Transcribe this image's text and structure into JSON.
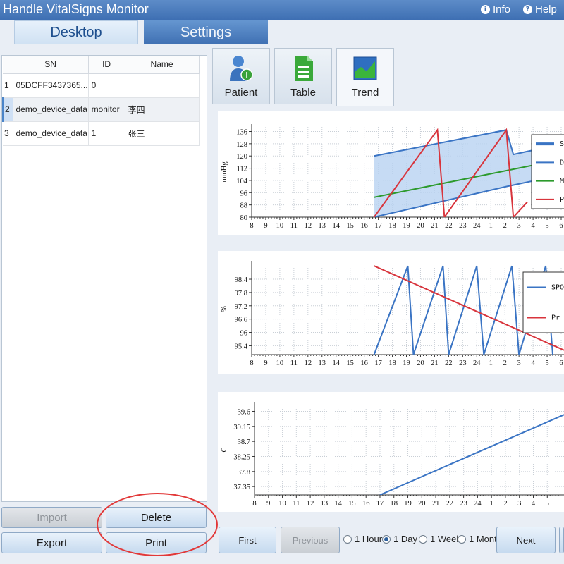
{
  "app": {
    "title": "Handle VitalSigns Monitor",
    "info_label": "Info",
    "help_label": "Help"
  },
  "tabs": {
    "desktop": "Desktop",
    "settings": "Settings"
  },
  "devices": {
    "columns": [
      "SN",
      "ID",
      "Name"
    ],
    "rows": [
      {
        "num": "1",
        "sn": "05DCFF3437365...",
        "id": "0",
        "name": ""
      },
      {
        "num": "2",
        "sn": "demo_device_data",
        "id": "monitor",
        "name": "李四"
      },
      {
        "num": "3",
        "sn": "demo_device_data",
        "id": "1",
        "name": "张三"
      }
    ],
    "selected_row": 2
  },
  "buttons": {
    "import": "Import",
    "delete": "Delete",
    "export": "Export",
    "print": "Print",
    "first": "First",
    "previous": "Previous",
    "next": "Next"
  },
  "view_tabs": {
    "patient": "Patient",
    "table": "Table",
    "trend": "Trend"
  },
  "ranges": [
    {
      "label": "1 Hour",
      "selected": false
    },
    {
      "label": "1 Day",
      "selected": true
    },
    {
      "label": "1 Weel",
      "selected": false
    },
    {
      "label": "1 Mont",
      "selected": false
    }
  ],
  "colors": {
    "blue": "#3a74c4",
    "green": "#2c9a2c",
    "red": "#d8343c",
    "band": "#b8d2f1",
    "highlight": "#e23838"
  },
  "chart_data": [
    {
      "type": "line",
      "ylabel": "mmHg",
      "xticks": [
        "8",
        "9",
        "10",
        "11",
        "12",
        "13",
        "14",
        "15",
        "16",
        "17",
        "18",
        "19",
        "20",
        "21",
        "22",
        "23",
        "24",
        "1",
        "2",
        "3",
        "4",
        "5",
        "6"
      ],
      "yticks": [
        80,
        88,
        96,
        104,
        112,
        120,
        128,
        136
      ],
      "xlim": [
        8,
        30.2
      ],
      "ylim": [
        80,
        139
      ],
      "legend": [
        "S",
        "D",
        "M",
        "P"
      ],
      "legend_position": "right",
      "series": [
        {
          "name": "S",
          "x": [
            16.7,
            26.1,
            26.6,
            27.6,
            30.2
          ],
          "y": [
            120,
            137,
            121,
            123,
            128
          ]
        },
        {
          "name": "D",
          "x": [
            16.7,
            26.1,
            30.2
          ],
          "y": [
            80,
            100,
            108
          ]
        },
        {
          "name": "M",
          "x": [
            16.7,
            30.2
          ],
          "y": [
            93,
            118
          ]
        },
        {
          "name": "P",
          "x": [
            16.7,
            21.2,
            21.7,
            26.1,
            26.6,
            27.6
          ],
          "y": [
            80,
            137,
            80,
            137,
            80,
            90
          ]
        }
      ]
    },
    {
      "type": "line",
      "ylabel": "%",
      "xticks": [
        "8",
        "9",
        "10",
        "11",
        "12",
        "13",
        "14",
        "15",
        "16",
        "17",
        "18",
        "19",
        "20",
        "21",
        "22",
        "23",
        "24",
        "1",
        "2",
        "3",
        "4",
        "5",
        "6"
      ],
      "yticks": [
        95.4,
        96,
        96.6,
        97.2,
        97.8,
        98.4
      ],
      "xlim": [
        8,
        30.2
      ],
      "ylim": [
        95,
        99.1
      ],
      "legend": [
        "SPO",
        "Pr"
      ],
      "legend_position": "right",
      "series": [
        {
          "name": "SPO",
          "x": [
            16.7,
            19.1,
            19.5,
            21.6,
            22.0,
            24.0,
            24.5,
            26.5,
            27.0,
            28.9,
            29.4
          ],
          "y": [
            95,
            99,
            95,
            99,
            95,
            99,
            95,
            99,
            95,
            99,
            95
          ]
        },
        {
          "name": "Pr",
          "x": [
            16.7,
            30.2
          ],
          "y": [
            99,
            95.2
          ]
        }
      ]
    },
    {
      "type": "line",
      "ylabel": "C",
      "xticks": [
        "8",
        "9",
        "10",
        "11",
        "12",
        "13",
        "14",
        "15",
        "16",
        "17",
        "18",
        "19",
        "20",
        "21",
        "22",
        "23",
        "24",
        "1",
        "2",
        "3",
        "4",
        "5"
      ],
      "yticks": [
        37.35,
        37.8,
        38.25,
        38.7,
        39.15,
        39.6
      ],
      "xlim": [
        8,
        30.2
      ],
      "ylim": [
        37.1,
        39.8
      ],
      "series": [
        {
          "name": "",
          "x": [
            17.0,
            30.2
          ],
          "y": [
            37.1,
            39.5
          ]
        }
      ]
    }
  ]
}
